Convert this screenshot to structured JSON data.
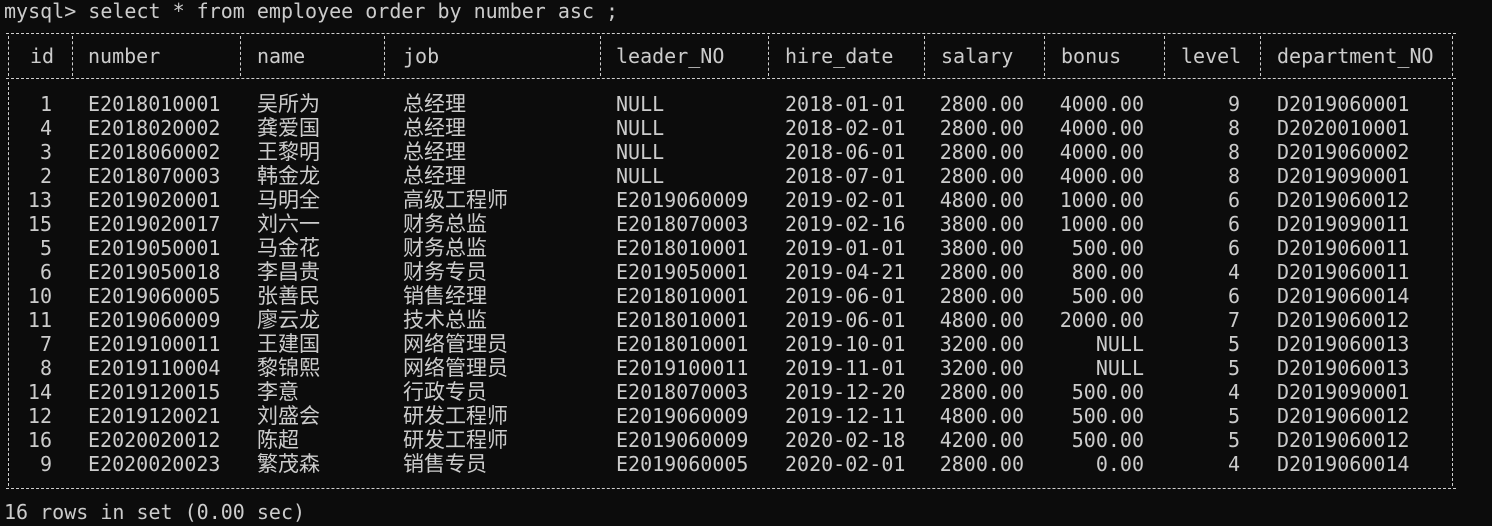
{
  "command": "mysql> select * from employee order by number asc ;",
  "columns": [
    "id",
    "number",
    "name",
    "job",
    "leader_NO",
    "hire_date",
    "salary",
    "bonus",
    "level",
    "department_NO"
  ],
  "rows": [
    [
      "1",
      "E2018010001",
      "吴所为",
      "总经理",
      "NULL",
      "2018-01-01",
      "2800.00",
      "4000.00",
      "9",
      "D2019060001"
    ],
    [
      "4",
      "E2018020002",
      "龚爱国",
      "总经理",
      "NULL",
      "2018-02-01",
      "2800.00",
      "4000.00",
      "8",
      "D2020010001"
    ],
    [
      "3",
      "E2018060002",
      "王黎明",
      "总经理",
      "NULL",
      "2018-06-01",
      "2800.00",
      "4000.00",
      "8",
      "D2019060002"
    ],
    [
      "2",
      "E2018070003",
      "韩金龙",
      "总经理",
      "NULL",
      "2018-07-01",
      "2800.00",
      "4000.00",
      "8",
      "D2019090001"
    ],
    [
      "13",
      "E2019020001",
      "马明全",
      "高级工程师",
      "E2019060009",
      "2019-02-01",
      "4800.00",
      "1000.00",
      "6",
      "D2019060012"
    ],
    [
      "15",
      "E2019020017",
      "刘六一",
      "财务总监",
      "E2018070003",
      "2019-02-16",
      "3800.00",
      "1000.00",
      "6",
      "D2019090011"
    ],
    [
      "5",
      "E2019050001",
      "马金花",
      "财务总监",
      "E2018010001",
      "2019-01-01",
      "3800.00",
      "500.00",
      "6",
      "D2019060011"
    ],
    [
      "6",
      "E2019050018",
      "李昌贵",
      "财务专员",
      "E2019050001",
      "2019-04-21",
      "2800.00",
      "800.00",
      "4",
      "D2019060011"
    ],
    [
      "10",
      "E2019060005",
      "张善民",
      "销售经理",
      "E2018010001",
      "2019-06-01",
      "2800.00",
      "500.00",
      "6",
      "D2019060014"
    ],
    [
      "11",
      "E2019060009",
      "廖云龙",
      "技术总监",
      "E2018010001",
      "2019-06-01",
      "4800.00",
      "2000.00",
      "7",
      "D2019060012"
    ],
    [
      "7",
      "E2019100011",
      "王建国",
      "网络管理员",
      "E2018010001",
      "2019-10-01",
      "3200.00",
      "NULL",
      "5",
      "D2019060013"
    ],
    [
      "8",
      "E2019110004",
      "黎锦熙",
      "网络管理员",
      "E2019100011",
      "2019-11-01",
      "3200.00",
      "NULL",
      "5",
      "D2019060013"
    ],
    [
      "14",
      "E2019120015",
      "李意",
      "行政专员",
      "E2018070003",
      "2019-12-20",
      "2800.00",
      "500.00",
      "4",
      "D2019090001"
    ],
    [
      "12",
      "E2019120021",
      "刘盛会",
      "研发工程师",
      "E2019060009",
      "2019-12-11",
      "4800.00",
      "500.00",
      "5",
      "D2019060012"
    ],
    [
      "16",
      "E2020020012",
      "陈超",
      "研发工程师",
      "E2019060009",
      "2020-02-18",
      "4200.00",
      "500.00",
      "5",
      "D2019060012"
    ],
    [
      "9",
      "E2020020023",
      "繁茂森",
      "销售专员",
      "E2019060005",
      "2020-02-01",
      "2800.00",
      "0.00",
      "4",
      "D2019060014"
    ]
  ],
  "footer": "16 rows in set (0.00 sec)",
  "colors": {
    "background": "#0c0c0c",
    "text": "#cccccc"
  }
}
